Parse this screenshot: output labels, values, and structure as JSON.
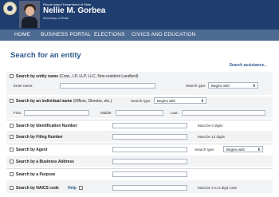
{
  "header": {
    "dept": "Rhode Island Department of State",
    "name": "Nellie M. Gorbea",
    "subtitle": "Secretary of State"
  },
  "nav": [
    "HOME",
    "BUSINESS PORTAL",
    "ELECTIONS",
    "CIVICS AND EDUCATION"
  ],
  "page": {
    "title": "Search for an entity",
    "assist": "Search assistance.."
  },
  "entity_name": {
    "label": "Search by entity name",
    "note": "(Corp., LP, LLP, LLC, Non-resident Landlord)",
    "field_label": "Enter name:",
    "search_type_label": "Search type:",
    "search_type_value": "Begins with"
  },
  "individual": {
    "label": "Search by an individual name",
    "note": "(Officer, Director, etc.)",
    "search_type_label": "Search type:",
    "search_type_value": "Begins with",
    "first_label": "First:",
    "middle_label": "Middle:",
    "last_label": "Last:"
  },
  "rows": {
    "id_number": {
      "label": "Search by Identification Number",
      "hint": "Must be 9 digits"
    },
    "filing_number": {
      "label": "Search by Filing Number",
      "hint": "Must be 12 digits"
    },
    "agent": {
      "label": "Search by Agent",
      "search_type_label": "Search type:",
      "search_type_value": "Begins with"
    },
    "business_address": {
      "label": "Search by a Business Address"
    },
    "purpose": {
      "label": "Search by a Purpose"
    },
    "naics": {
      "label": "Search by NAICS code",
      "help": "Help",
      "hint": "Must be 2 to 6 digit code"
    }
  },
  "icons": {
    "caret": "⬍"
  }
}
